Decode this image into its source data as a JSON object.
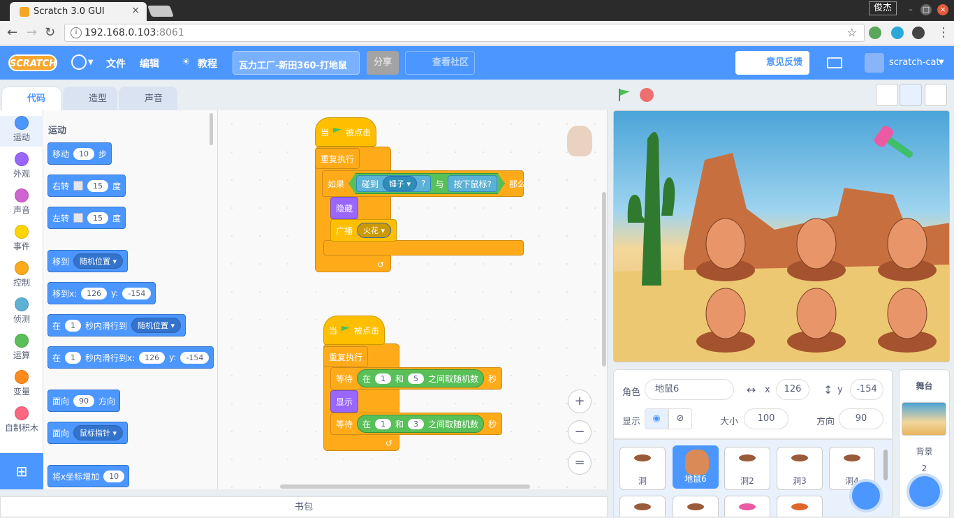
{
  "browser": {
    "tab_title": "Scratch 3.0 GUI",
    "tab_close": "×",
    "user": "俊杰",
    "url_host": "192.168.0.103",
    "url_port": ":8061",
    "star": "☆",
    "info": "i"
  },
  "menubar": {
    "logo": "SCRATCH",
    "file": "文件",
    "edit": "编辑",
    "tutorials": "教程",
    "project_title": "瓦力工厂-新田360-打地鼠",
    "share": "分享",
    "community": "查看社区",
    "feedback": "意见反馈",
    "username": "scratch-cat"
  },
  "editor_tabs": {
    "code": "代码",
    "costumes": "造型",
    "sounds": "声音"
  },
  "categories": [
    {
      "label": "运动",
      "color": "#4c97ff"
    },
    {
      "label": "外观",
      "color": "#9966ff"
    },
    {
      "label": "声音",
      "color": "#cf63cf"
    },
    {
      "label": "事件",
      "color": "#ffd500"
    },
    {
      "label": "控制",
      "color": "#ffab19"
    },
    {
      "label": "侦测",
      "color": "#5cb1d6"
    },
    {
      "label": "运算",
      "color": "#59c059"
    },
    {
      "label": "变量",
      "color": "#ff8c1a"
    },
    {
      "label": "自制积木",
      "color": "#ff6680"
    }
  ],
  "palette": {
    "heading": "运动",
    "move": {
      "label": "移动",
      "steps": "10",
      "unit": "步"
    },
    "turn_right": {
      "label": "右转",
      "deg": "15",
      "unit": "度"
    },
    "turn_left": {
      "label": "左转",
      "deg": "15",
      "unit": "度"
    },
    "goto": {
      "label": "移到",
      "target": "随机位置"
    },
    "goto_xy": {
      "label": "移到x:",
      "x": "126",
      "ylabel": "y:",
      "y": "-154"
    },
    "glide": {
      "pre": "在",
      "secs": "1",
      "mid": "秒内滑行到",
      "target": "随机位置"
    },
    "glide_xy": {
      "pre": "在",
      "secs": "1",
      "mid": "秒内滑行到x:",
      "x": "126",
      "ylabel": "y:",
      "y": "-154"
    },
    "point_dir": {
      "label": "面向",
      "dir": "90",
      "unit": "方向"
    },
    "point_to": {
      "label": "面向",
      "target": "鼠标指针"
    },
    "change_x": {
      "label": "将x坐标增加",
      "value": "10"
    }
  },
  "script1": {
    "hat": "当",
    "hat_suffix": "被点击",
    "forever": "重复执行",
    "if": "如果",
    "touching": "碰到",
    "touch_target": "锤子",
    "qmark": "?",
    "and": "与",
    "mouse_down": "按下鼠标?",
    "then": "那么",
    "hide": "隐藏",
    "broadcast": "广播",
    "message": "火花"
  },
  "script2": {
    "hat": "当",
    "hat_suffix": "被点击",
    "forever": "重复执行",
    "wait": "等待",
    "pick_pre": "在",
    "from1": "1",
    "and_word": "和",
    "to1": "5",
    "pick_suffix": "之间取随机数",
    "secs": "秒",
    "show": "显示",
    "from2": "1",
    "to2": "3"
  },
  "zoom": {
    "in": "+",
    "out": "−",
    "reset": "="
  },
  "backpack": "书包",
  "sprite_info": {
    "sprite_label": "角色",
    "sprite_name": "地鼠6",
    "x_label": "x",
    "x": "126",
    "y_label": "y",
    "y": "-154",
    "show_label": "显示",
    "size_label": "大小",
    "size": "100",
    "direction_label": "方向",
    "direction": "90"
  },
  "sprites": [
    {
      "name": "洞"
    },
    {
      "name": "地鼠6"
    },
    {
      "name": "洞2"
    },
    {
      "name": "洞3"
    },
    {
      "name": "洞4"
    }
  ],
  "stage_panel": {
    "title": "舞台",
    "backdrops_label": "背景",
    "backdrops_count": "2"
  }
}
